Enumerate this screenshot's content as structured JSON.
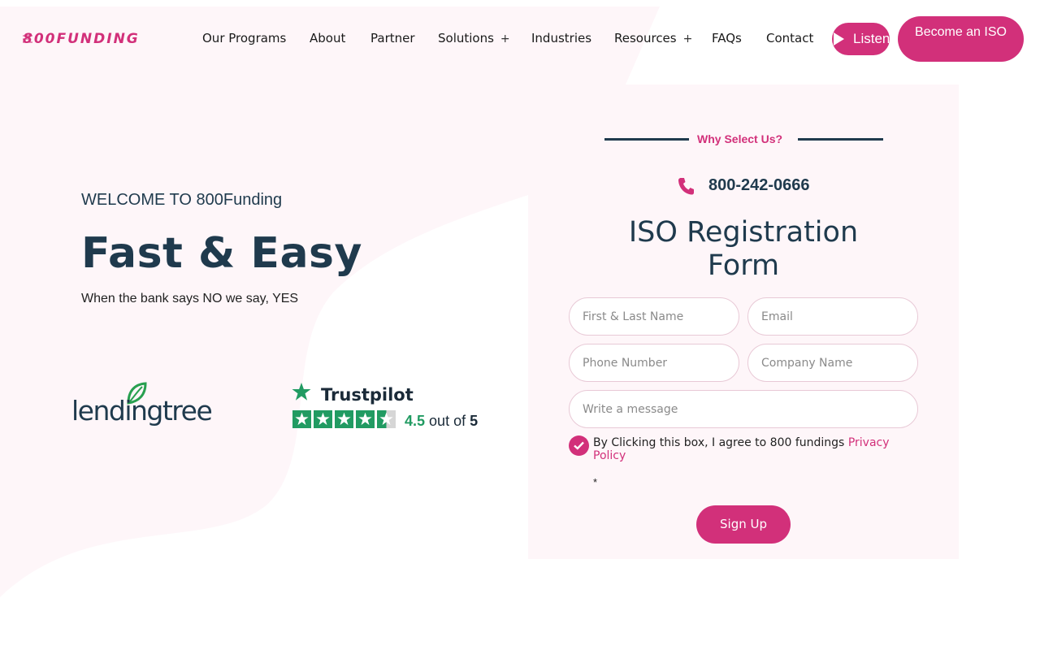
{
  "brand": {
    "logo_text": "800FUNDING",
    "accent_color": "#d2307a",
    "text_color": "#1f3a4d"
  },
  "nav": {
    "items": [
      {
        "label": "Our Programs",
        "has_plus": false
      },
      {
        "label": "About",
        "has_plus": false
      },
      {
        "label": "Partner",
        "has_plus": false
      },
      {
        "label": "Solutions",
        "has_plus": true
      },
      {
        "label": "Industries",
        "has_plus": false
      },
      {
        "label": "Resources",
        "has_plus": true
      },
      {
        "label": "FAQs",
        "has_plus": false
      },
      {
        "label": "Contact",
        "has_plus": false
      }
    ],
    "plus_symbol": "+",
    "listen_label": "Listen",
    "cta_label": "Become an ISO"
  },
  "hero": {
    "welcome": "WELCOME TO 800Funding",
    "title": "Fast & Easy",
    "subtitle": "When the bank says NO we say, YES"
  },
  "badges": {
    "lendingtree": "lendingtree",
    "trustpilot_name": "Trustpilot",
    "trustpilot_score": "4.5",
    "trustpilot_out_of": "out of",
    "trustpilot_max": "5",
    "trustpilot_rating": 4.5
  },
  "form": {
    "why_label": "Why Select Us?",
    "phone": "800-242-0666",
    "title": "ISO Registration Form",
    "fields": {
      "name_placeholder": "First & Last Name",
      "email_placeholder": "Email",
      "phone_placeholder": "Phone Number",
      "company_placeholder": "Company Name",
      "message_placeholder": "Write a message"
    },
    "consent_text": "By Clicking this box, I agree to 800 fundings ",
    "consent_link": "Privacy Policy",
    "consent_checked": true,
    "required_mark": "*",
    "submit_label": "Sign Up"
  }
}
